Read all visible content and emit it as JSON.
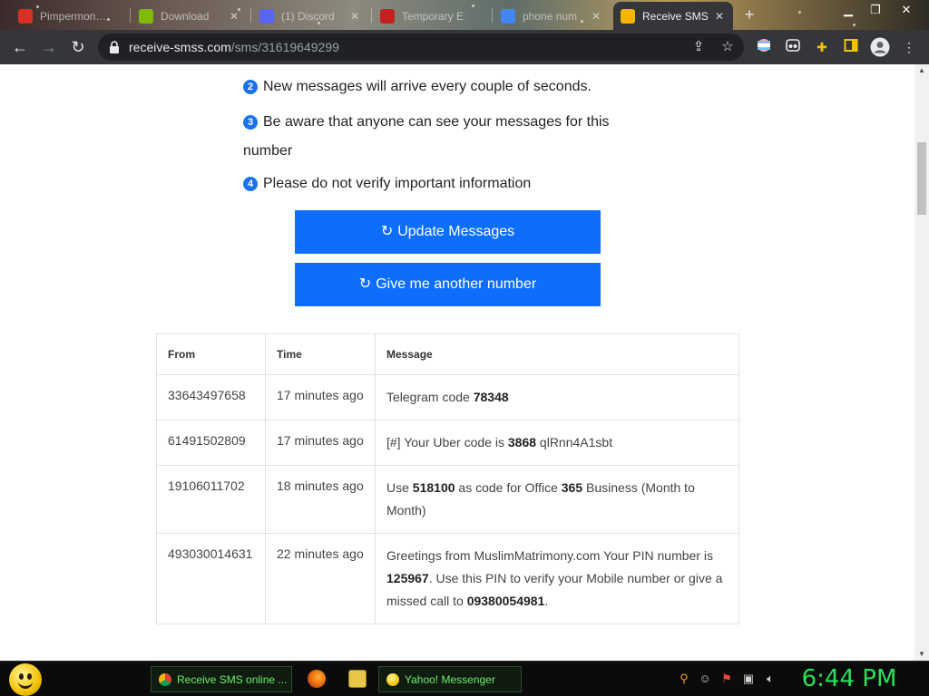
{
  "browser": {
    "tabs": [
      {
        "label": "Pimpermon…",
        "favicon": "gmail-icon",
        "color": "#d93025"
      },
      {
        "label": "Download",
        "favicon": "microsoft-icon",
        "color": "#7fba00"
      },
      {
        "label": "(1) Discord",
        "favicon": "discord-icon",
        "color": "#5865f2"
      },
      {
        "label": "Temporary E",
        "favicon": "mail-icon",
        "color": "#c5221f"
      },
      {
        "label": "phone num",
        "favicon": "google-icon",
        "color": "#4285f4"
      },
      {
        "label": "Receive SMS",
        "favicon": "sms-site-icon",
        "color": "#f4b400"
      }
    ],
    "url_host": "receive-smss.com",
    "url_path": "/sms/31619649299",
    "new_tab_glyph": "+"
  },
  "notes": [
    {
      "num": "2",
      "text": "New messages will arrive every couple of seconds."
    },
    {
      "num": "3",
      "text": "Be aware that anyone can see your messages for this number"
    },
    {
      "num": "4",
      "text": "Please do not verify important information"
    }
  ],
  "buttons": {
    "update": "Update Messages",
    "another": "Give me another number",
    "refresh_glyph": "↻"
  },
  "table": {
    "headers": [
      "From",
      "Time",
      "Message"
    ],
    "rows": [
      {
        "from": "33643497658",
        "time": "17 minutes ago",
        "message": [
          {
            "t": "Telegram code "
          },
          {
            "b": "78348"
          }
        ]
      },
      {
        "from": "61491502809",
        "time": "17 minutes ago",
        "message": [
          {
            "t": "[#] Your Uber code is "
          },
          {
            "b": "3868"
          },
          {
            "t": " qlRnn4A1sbt"
          }
        ]
      },
      {
        "from": "19106011702",
        "time": "18 minutes ago",
        "message": [
          {
            "t": "Use "
          },
          {
            "b": "518100"
          },
          {
            "t": " as code for Office "
          },
          {
            "b": "365"
          },
          {
            "t": " Business (Month to Month)"
          }
        ]
      },
      {
        "from": "493030014631",
        "time": "22 minutes ago",
        "message": [
          {
            "t": "Greetings from MuslimMatrimony.com Your PIN number is "
          },
          {
            "b": "125967"
          },
          {
            "t": ". Use this PIN to verify your Mobile number or give a missed call to "
          },
          {
            "b": "09380054981"
          },
          {
            "t": "."
          }
        ]
      }
    ]
  },
  "taskbar": {
    "tasks": [
      {
        "label": "Receive SMS online ...",
        "icon": "chrome-icon"
      },
      {
        "label": "Yahoo! Messenger",
        "icon": "yahoo-messenger-icon"
      }
    ],
    "clock": "6:44 PM"
  }
}
